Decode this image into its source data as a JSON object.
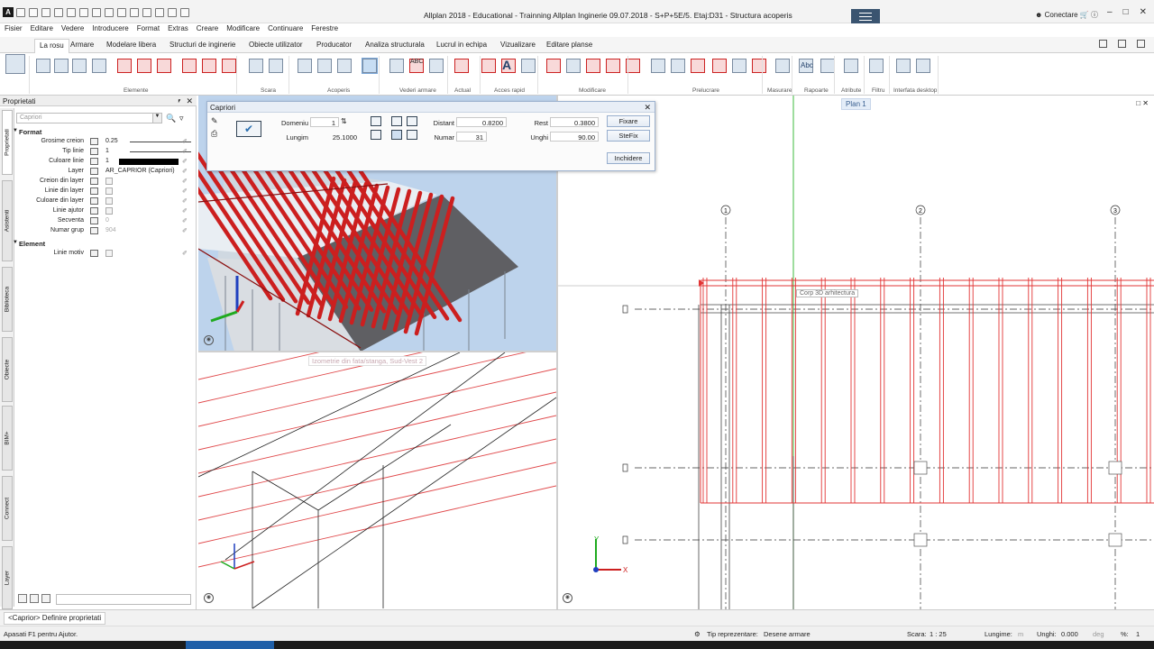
{
  "app": {
    "title": "Allplan 2018 - Educational - Trainning Allplan Inginerie 09.07.2018 - S+P+5E/5. Etaj:D31 - Structura acoperis",
    "icon_letter": "A",
    "connect_label": "Conectare"
  },
  "menu": [
    "Fisier",
    "Editare",
    "Vedere",
    "Introducere",
    "Format",
    "Extras",
    "Creare",
    "Modificare",
    "Continuare",
    "Ferestre"
  ],
  "tabs": [
    "La rosu",
    "Armare",
    "Modelare libera",
    "Structuri de inginerie",
    "Obiecte utilizator",
    "Producator",
    "Analiza structurala",
    "Lucrul in echipa",
    "Vizualizare",
    "Editare planse"
  ],
  "ribbon_groups": [
    "Elemente",
    "Scara",
    "Acoperis",
    "Vederi armare",
    "Actual",
    "Acces rapid",
    "Modificare",
    "Prelucrare",
    "Masurare",
    "Rapoarte",
    "Atribute",
    "Filtru",
    "Interfata desktop"
  ],
  "ribbon_labels": {
    "abc_1": "ABC",
    "abc_2": "Abc",
    "text_tool": "A"
  },
  "properties": {
    "title": "Proprietati",
    "filter_placeholder": "Capriori",
    "section_format": "Format",
    "rows": [
      {
        "label": "Grosime creion",
        "value": "0.25"
      },
      {
        "label": "Tip linie",
        "value": "1"
      },
      {
        "label": "Culoare linie",
        "value": "1"
      },
      {
        "label": "Layer",
        "value": "AR_CAPRIOR (Capriori)"
      },
      {
        "label": "Creion din layer",
        "value": ""
      },
      {
        "label": "Linie din layer",
        "value": ""
      },
      {
        "label": "Culoare din layer",
        "value": ""
      },
      {
        "label": "Linie ajutor",
        "value": ""
      },
      {
        "label": "Secventa",
        "value": "0"
      },
      {
        "label": "Numar grup",
        "value": "904"
      }
    ],
    "section_element": "Element",
    "element_rows": [
      {
        "label": "Linie motiv",
        "value": ""
      }
    ],
    "side_tabs": [
      "Proprietati",
      "Asistenti",
      "Biblioteca",
      "Obiecte",
      "BIM+",
      "Connect",
      "Layer"
    ]
  },
  "dialog": {
    "title": "Capriori",
    "domeniu_label": "Domeniu",
    "domeniu_value": "1",
    "lungim_label": "Lungim",
    "lungim_value": "25.1000",
    "distant_label": "Distant",
    "distant_value": "0.8200",
    "numar_label": "Numar",
    "numar_value": "31",
    "rest_label": "Rest",
    "rest_value": "0.3800",
    "unghi_label": "Unghi",
    "unghi_value": "90.00",
    "fixare_label": "Fixare",
    "stefix_label": "SteFix",
    "close_label": "Inchidere"
  },
  "viewports": {
    "elevation_label": "Izometrie din fata/stanga, Sud-Vest 2",
    "plan_label": "Plan 1",
    "tooltip": "Corp 3D arhitectura",
    "grid_axes": [
      "1",
      "2",
      "3"
    ]
  },
  "commandline": {
    "tab": "<Caprior> Definire proprietati"
  },
  "status": {
    "hint": "Apasati F1 pentru Ajutor.",
    "repr_label": "Tip reprezentare:",
    "repr_value": "Desene armare",
    "scale_label": "Scara:",
    "scale_value": "1 : 25",
    "length_label": "Lungime:",
    "length_unit": "m",
    "angle_label": "Unghi:",
    "angle_value": "0.000",
    "angle_unit": "deg",
    "percent_label": "%:",
    "percent_value": "1"
  }
}
